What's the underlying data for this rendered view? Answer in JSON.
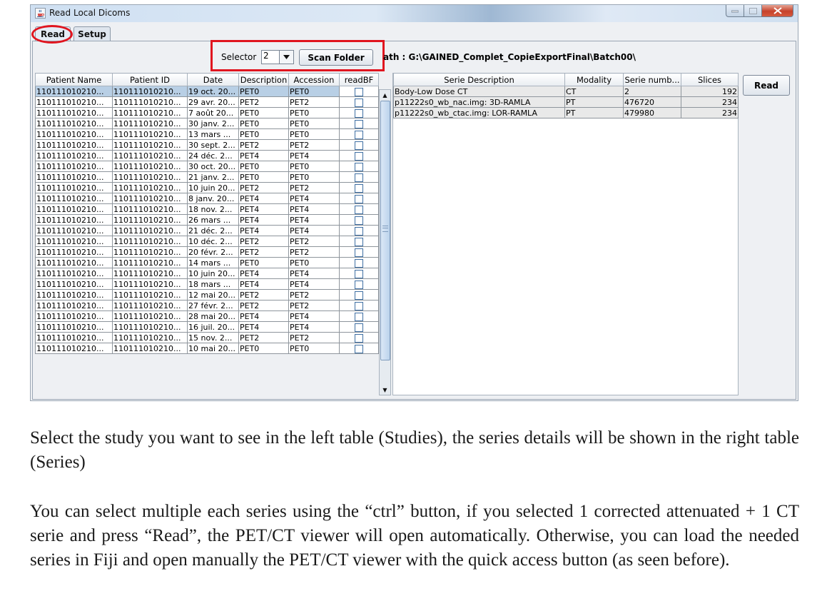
{
  "window": {
    "title": "Read Local Dicoms",
    "icon": "java-cup-icon",
    "controls": [
      "minimize-icon",
      "maximize-icon",
      "close-icon"
    ]
  },
  "tabs": [
    {
      "label": "Read",
      "selected": true
    },
    {
      "label": "Setup",
      "selected": false
    }
  ],
  "controls": {
    "selector_label": "Selector",
    "selector_value": "2",
    "scan_button": "Scan Folder",
    "path": "ath : G:\\GAINED_Complet_CopieExportFinal\\Batch00\\",
    "read_button": "Read"
  },
  "studies": {
    "columns": [
      "Patient Name",
      "Patient ID",
      "Date",
      "Description",
      "Accession",
      "readBF"
    ],
    "rows": [
      [
        "110111010210...",
        "110111010210...",
        "19 oct. 20...",
        "PET0",
        "PET0"
      ],
      [
        "110111010210...",
        "110111010210...",
        "29 avr. 20...",
        "PET2",
        "PET2"
      ],
      [
        "110111010210...",
        "110111010210...",
        "7 août 20...",
        "PET0",
        "PET0"
      ],
      [
        "110111010210...",
        "110111010210...",
        "30 janv. 2...",
        "PET0",
        "PET0"
      ],
      [
        "110111010210...",
        "110111010210...",
        "13 mars ...",
        "PET0",
        "PET0"
      ],
      [
        "110111010210...",
        "110111010210...",
        "30 sept. 2...",
        "PET2",
        "PET2"
      ],
      [
        "110111010210...",
        "110111010210...",
        "24 déc. 2...",
        "PET4",
        "PET4"
      ],
      [
        "110111010210...",
        "110111010210...",
        "30 oct. 20...",
        "PET0",
        "PET0"
      ],
      [
        "110111010210...",
        "110111010210...",
        "21 janv. 2...",
        "PET0",
        "PET0"
      ],
      [
        "110111010210...",
        "110111010210...",
        "10 juin 20...",
        "PET2",
        "PET2"
      ],
      [
        "110111010210...",
        "110111010210...",
        "8 janv. 20...",
        "PET4",
        "PET4"
      ],
      [
        "110111010210...",
        "110111010210...",
        "18 nov. 2...",
        "PET4",
        "PET4"
      ],
      [
        "110111010210...",
        "110111010210...",
        "26 mars ...",
        "PET4",
        "PET4"
      ],
      [
        "110111010210...",
        "110111010210...",
        "21 déc. 2...",
        "PET4",
        "PET4"
      ],
      [
        "110111010210...",
        "110111010210...",
        "10 déc. 2...",
        "PET2",
        "PET2"
      ],
      [
        "110111010210...",
        "110111010210...",
        "20 févr. 2...",
        "PET2",
        "PET2"
      ],
      [
        "110111010210...",
        "110111010210...",
        "14 mars ...",
        "PET0",
        "PET0"
      ],
      [
        "110111010210...",
        "110111010210...",
        "10 juin 20...",
        "PET4",
        "PET4"
      ],
      [
        "110111010210...",
        "110111010210...",
        "18 mars ...",
        "PET4",
        "PET4"
      ],
      [
        "110111010210...",
        "110111010210...",
        "12 mai 20...",
        "PET2",
        "PET2"
      ],
      [
        "110111010210...",
        "110111010210...",
        "27 févr. 2...",
        "PET2",
        "PET2"
      ],
      [
        "110111010210...",
        "110111010210...",
        "28 mai 20...",
        "PET4",
        "PET4"
      ],
      [
        "110111010210...",
        "110111010210...",
        "16 juil. 20...",
        "PET4",
        "PET4"
      ],
      [
        "110111010210...",
        "110111010210...",
        "15 nov. 2...",
        "PET2",
        "PET2"
      ],
      [
        "110111010210...",
        "110111010210...",
        "10 mai 20...",
        "PET0",
        "PET0"
      ]
    ]
  },
  "series": {
    "columns": [
      "Serie Description",
      "Modality",
      "Serie numb...",
      "Slices"
    ],
    "rows": [
      [
        "Body-Low Dose CT",
        "CT",
        "2",
        "192"
      ],
      [
        "p11222s0_wb_nac.img: 3D-RAMLA",
        "PT",
        "476720",
        "234"
      ],
      [
        "p11222s0_wb_ctac.img: LOR-RAMLA",
        "PT",
        "479980",
        "234"
      ]
    ]
  },
  "document": {
    "para1": "Select the study you want to see in the left table (Studies), the series details will be shown in the right table (Series)",
    "para2": "You can select multiple each series using the “ctrl” button, if you selected 1 corrected attenuated + 1 CT serie and press “Read”, the PET/CT viewer will open automatically. Otherwise, you can load the needed series in Fiji and open manually the PET/CT viewer with the quick access button (as seen before)."
  },
  "colors": {
    "highlight": "#e0151f",
    "selected_row": "#b8cfe5",
    "series_row": "#e9e9e9"
  }
}
